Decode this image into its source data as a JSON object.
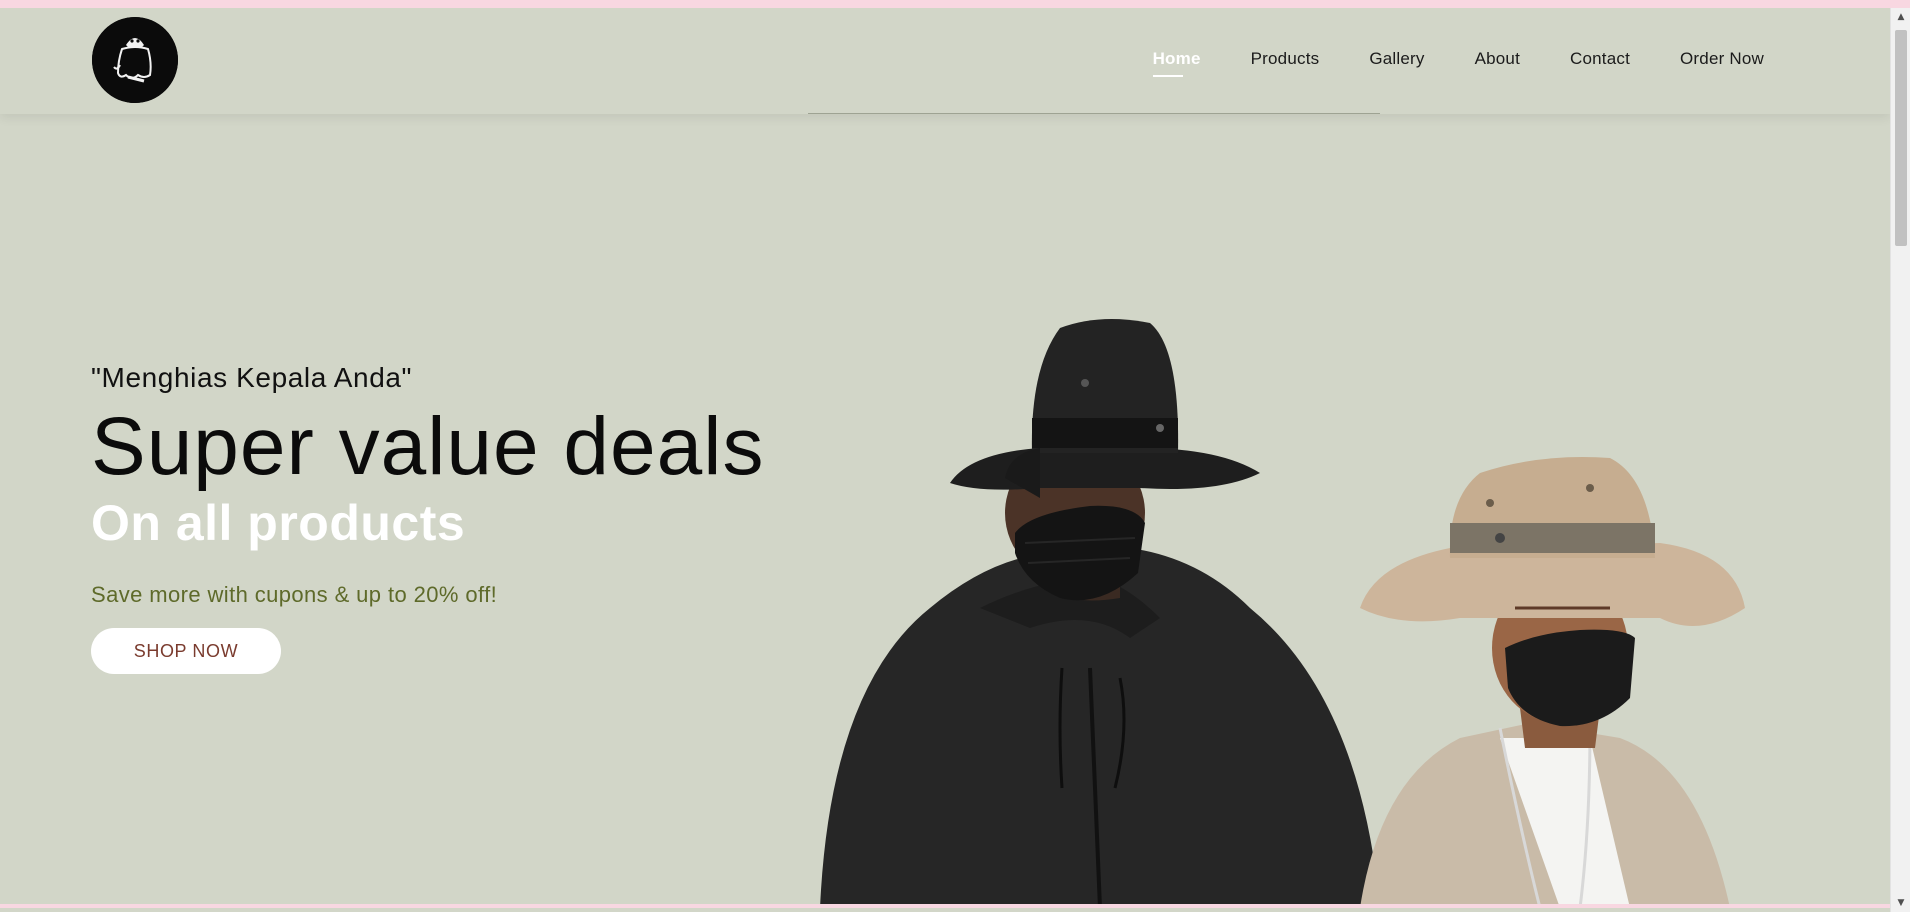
{
  "nav": {
    "items": [
      {
        "label": "Home",
        "active": true
      },
      {
        "label": "Products",
        "active": false
      },
      {
        "label": "Gallery",
        "active": false
      },
      {
        "label": "About",
        "active": false
      },
      {
        "label": "Contact",
        "active": false
      },
      {
        "label": "Order Now",
        "active": false
      }
    ]
  },
  "hero": {
    "tagline": "\"Menghias Kepala Anda\"",
    "headline": "Super value deals",
    "subhead": "On all products",
    "promo": "Save more with cupons & up to 20% off!",
    "cta_label": "SHOP NOW",
    "image_icon": "hero-models-image"
  },
  "colors": {
    "background": "#d2d6c8",
    "accent_white": "#ffffff",
    "promo_green": "#5e6a2a",
    "cta_text": "#7a3b2e",
    "top_strip": "#f8d7e1"
  },
  "icons": {
    "logo": "ghost-logo-icon",
    "scroll_up": "chevron-up-icon",
    "scroll_down": "chevron-down-icon"
  }
}
